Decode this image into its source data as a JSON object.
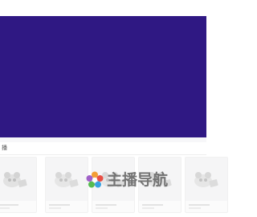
{
  "banner": {
    "color": "#2f1883"
  },
  "section": {
    "title": "播"
  },
  "cards": [
    {
      "icon": "panda-placeholder-icon"
    },
    {
      "icon": "panda-placeholder-icon"
    },
    {
      "icon": "panda-placeholder-icon"
    },
    {
      "icon": "panda-placeholder-icon"
    },
    {
      "icon": "panda-placeholder-icon"
    }
  ],
  "watermark": {
    "text": "主播导航",
    "logo": "flower-logo-icon"
  }
}
